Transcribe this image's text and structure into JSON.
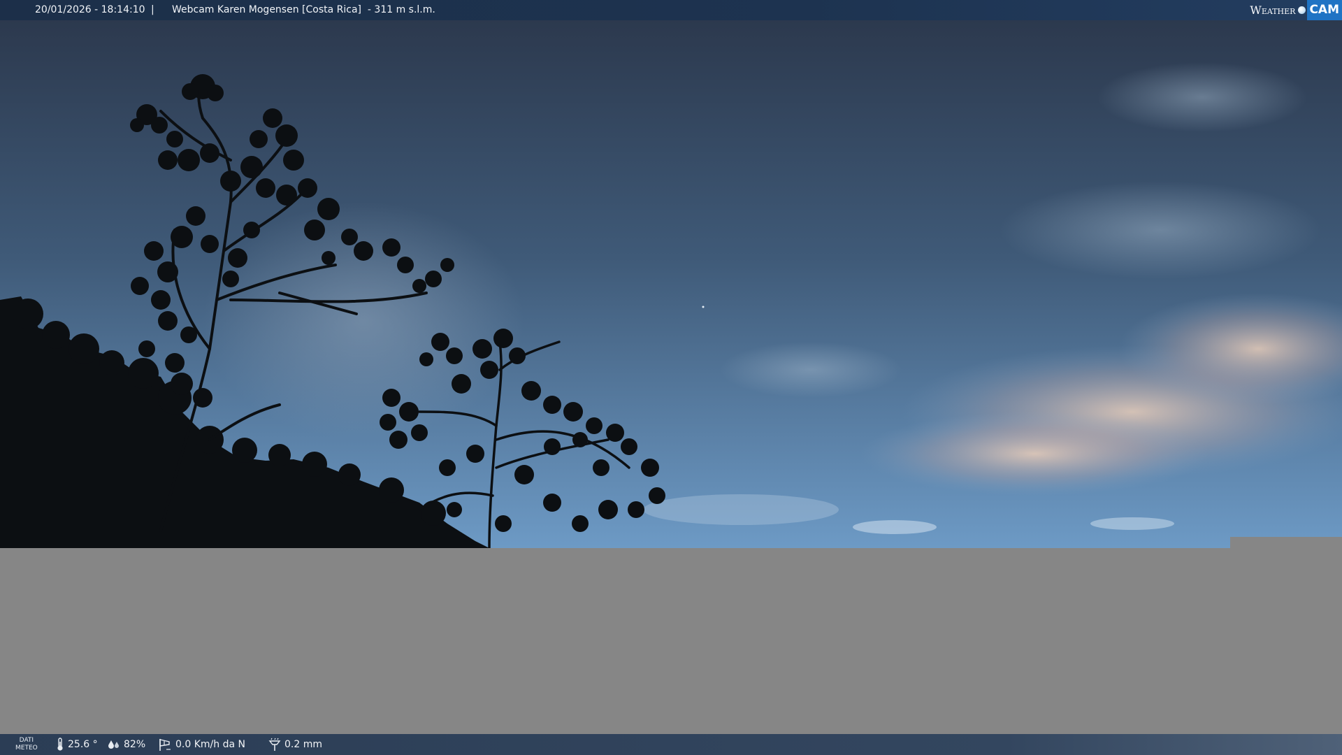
{
  "header": {
    "timestamp": "20/01/2026 - 18:14:10",
    "separator": "|",
    "camera_title": "Webcam Karen Mogensen [Costa Rica]  - 311 m s.l.m.",
    "logo_word": "Weather",
    "logo_badge": "CAM"
  },
  "footer": {
    "label_line1": "DATI",
    "label_line2": "METEO",
    "temperature": "25.6 °",
    "humidity": "82%",
    "wind": "0.0 Km/h da N",
    "rain": "0.2 mm"
  },
  "colors": {
    "sky_top": "#2e3c52",
    "sky_bottom": "#6f9bc4",
    "cloud_glow": "#e8cbb8",
    "foliage": "#0c0f12",
    "panel_gray": "#868686",
    "logo_blue": "#1f73c4"
  },
  "icons": {
    "temperature": "thermometer-icon",
    "humidity": "humidity-drops-icon",
    "wind": "wind-sock-icon",
    "rain": "rain-gauge-icon",
    "logo_sun": "sun-dot-icon"
  }
}
